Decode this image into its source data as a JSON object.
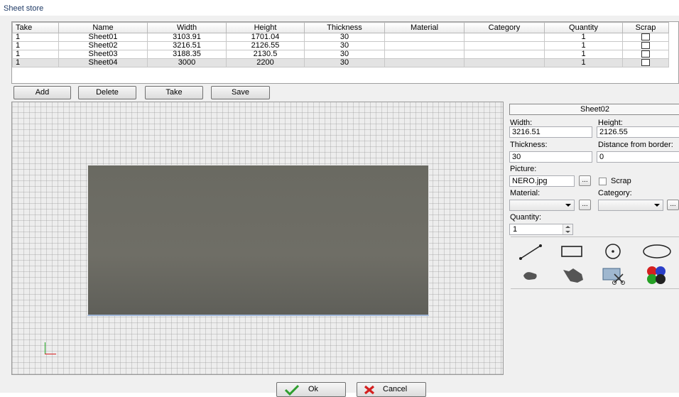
{
  "window": {
    "title": "Sheet store"
  },
  "grid": {
    "columns": [
      "Take",
      "Name",
      "Width",
      "Height",
      "Thickness",
      "Material",
      "Category",
      "Quantity",
      "Scrap"
    ],
    "rows": [
      {
        "take": "1",
        "name": "Sheet01",
        "width": "3103.91",
        "height": "1701.04",
        "thickness": "30",
        "material": "",
        "category": "",
        "quantity": "1",
        "scrap": false
      },
      {
        "take": "1",
        "name": "Sheet02",
        "width": "3216.51",
        "height": "2126.55",
        "thickness": "30",
        "material": "",
        "category": "",
        "quantity": "1",
        "scrap": false
      },
      {
        "take": "1",
        "name": "Sheet03",
        "width": "3188.35",
        "height": "2130.5",
        "thickness": "30",
        "material": "",
        "category": "",
        "quantity": "1",
        "scrap": false
      },
      {
        "take": "1",
        "name": "Sheet04",
        "width": "3000",
        "height": "2200",
        "thickness": "30",
        "material": "",
        "category": "",
        "quantity": "1",
        "scrap": false
      }
    ]
  },
  "actions": {
    "add": "Add",
    "delete": "Delete",
    "take": "Take",
    "save": "Save"
  },
  "panel": {
    "selected_sheet": "Sheet02",
    "width_label": "Width:",
    "width_value": "3216.51",
    "height_label": "Height:",
    "height_value": "2126.55",
    "thickness_label": "Thickness:",
    "thickness_value": "30",
    "distance_label": "Distance from border:",
    "distance_value": "0",
    "picture_label": "Picture:",
    "picture_value": "NERO.jpg",
    "browse_label": "...",
    "scrap_label": "Scrap",
    "material_label": "Material:",
    "material_value": "",
    "category_label": "Category:",
    "category_value": "",
    "quantity_label": "Quantity:",
    "quantity_value": "1"
  },
  "tools": [
    "line-tool-icon",
    "rectangle-tool-icon",
    "circle-tool-icon",
    "ellipse-tool-icon",
    "eraser-tool-icon",
    "hand-tool-icon",
    "image-cut-tool-icon",
    "color-tool-icon"
  ],
  "footer": {
    "ok": "Ok",
    "cancel": "Cancel"
  },
  "colors": {
    "accent_title": "#1f3a66",
    "sheet_fill": "#6a6a62",
    "ok_check": "#2e9e2e",
    "cancel_x": "#d42020"
  }
}
